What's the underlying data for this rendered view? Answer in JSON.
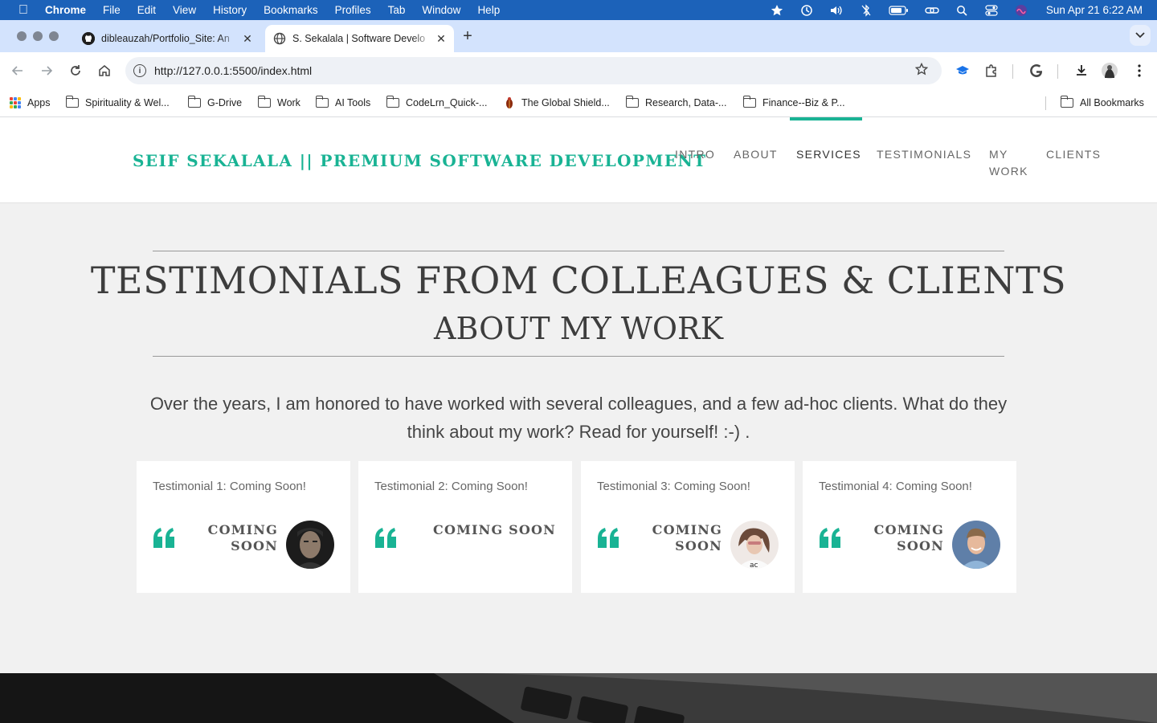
{
  "menubar": {
    "app": "Chrome",
    "items": [
      "File",
      "Edit",
      "View",
      "History",
      "Bookmarks",
      "Profiles",
      "Tab",
      "Window",
      "Help"
    ],
    "clock": "Sun Apr 21  6:22 AM"
  },
  "tabs": [
    {
      "title": "dibleauzah/Portfolio_Site: An",
      "favicon": "github-icon"
    },
    {
      "title": "S. Sekalala | Software Develo",
      "favicon": "globe-icon"
    }
  ],
  "toolbar": {
    "url": "http://127.0.0.1:5500/index.html"
  },
  "bookmarks": {
    "apps": "Apps",
    "items": [
      "Spirituality & Wel...",
      "G-Drive",
      "Work",
      "AI Tools",
      "CodeLrn_Quick-...",
      "The Global Shield...",
      "Research, Data-...",
      "Finance--Biz & P..."
    ],
    "all": "All Bookmarks"
  },
  "site": {
    "brand": "SEIF SEKALALA || PREMIUM SOFTWARE DEVELOPMENT",
    "nav": {
      "intro": "INTRO",
      "about": "ABOUT",
      "services": "SERVICES",
      "testimonials": "TESTIMONIALS",
      "mywork_line1": "MY",
      "mywork_line2": "WORK",
      "clients": "CLIENTS"
    },
    "active_nav": "SERVICES",
    "accent_color": "#19b394"
  },
  "section": {
    "heading_line1": "TESTIMONIALS FROM COLLEAGUES & CLIENTS",
    "heading_line2": "ABOUT MY WORK",
    "intro": "Over the years, I am honored to have worked with several colleagues, and a few ad-hoc clients. What do they think about my work? Read for yourself! :-) ."
  },
  "testimonials": [
    {
      "title": "Testimonial 1: Coming Soon!",
      "line1": "COMING",
      "line2": "SOON",
      "avatar": "man-dark-avatar"
    },
    {
      "title": "Testimonial 2: Coming Soon!",
      "line1": "COMING SOON",
      "line2": "",
      "avatar": ""
    },
    {
      "title": "Testimonial 3: Coming Soon!",
      "line1": "COMING",
      "line2": "SOON",
      "avatar": "woman-avatar"
    },
    {
      "title": "Testimonial 4: Coming Soon!",
      "line1": "COMING",
      "line2": "SOON",
      "avatar": "man-blue-avatar"
    }
  ]
}
